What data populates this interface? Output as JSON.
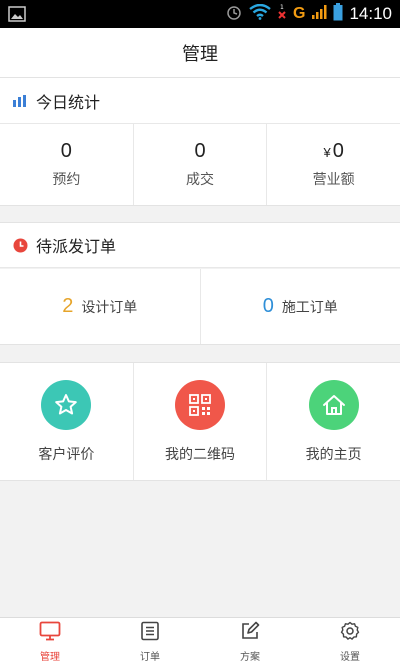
{
  "status_bar": {
    "time": "14:10",
    "network_letter": "G",
    "icons": [
      "image-icon",
      "alarm-icon",
      "wifi-icon",
      "signal-icon",
      "battery-icon"
    ]
  },
  "header": {
    "title": "管理"
  },
  "today_stats": {
    "title": "今日统计",
    "items": [
      {
        "value": "0",
        "label": "预约"
      },
      {
        "value": "0",
        "label": "成交"
      },
      {
        "currency": "¥",
        "value": "0",
        "label": "营业额"
      }
    ]
  },
  "pending_orders": {
    "title": "待派发订单",
    "items": [
      {
        "count": "2",
        "label": "设计订单",
        "color": "#e6a42a"
      },
      {
        "count": "0",
        "label": "施工订单",
        "color": "#2f8fd8"
      }
    ]
  },
  "shortcuts": [
    {
      "label": "客户评价",
      "icon": "star-icon",
      "color": "#3cc7b5"
    },
    {
      "label": "我的二维码",
      "icon": "qrcode-icon",
      "color": "#f0574a"
    },
    {
      "label": "我的主页",
      "icon": "home-icon",
      "color": "#4cd37a"
    }
  ],
  "tabbar": {
    "active_color": "#e8463c",
    "tabs": [
      {
        "label": "管理",
        "icon": "monitor-icon",
        "active": true
      },
      {
        "label": "订单",
        "icon": "list-icon",
        "active": false
      },
      {
        "label": "方案",
        "icon": "edit-icon",
        "active": false
      },
      {
        "label": "设置",
        "icon": "gear-icon",
        "active": false
      }
    ]
  }
}
